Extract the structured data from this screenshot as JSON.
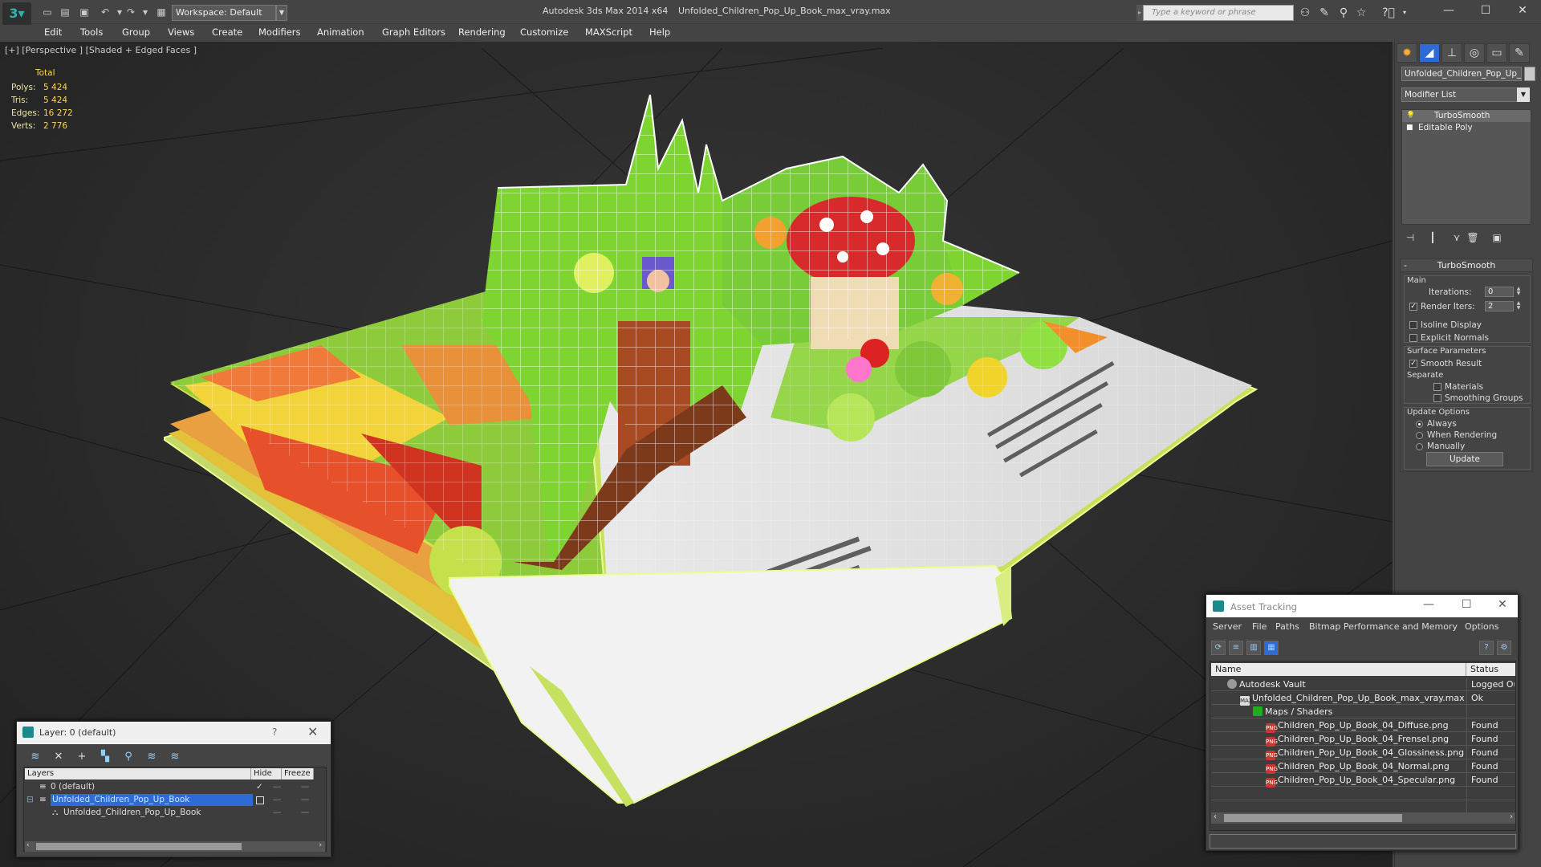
{
  "titlebar": {
    "app_title": "Autodesk 3ds Max  2014 x64",
    "file_title": "Unfolded_Children_Pop_Up_Book_max_vray.max",
    "workspace": "Workspace: Default",
    "search_placeholder": "Type a keyword or phrase"
  },
  "menubar": [
    "Edit",
    "Tools",
    "Group",
    "Views",
    "Create",
    "Modifiers",
    "Animation",
    "Graph Editors",
    "Rendering",
    "Customize",
    "MAXScript",
    "Help"
  ],
  "viewport": {
    "label": "[+] [Perspective ] [Shaded + Edged Faces ]",
    "stats_header": "Total",
    "stats": [
      {
        "key": "Polys:",
        "value": "5 424"
      },
      {
        "key": "Tris:",
        "value": "5 424"
      },
      {
        "key": "Edges:",
        "value": "16 272"
      },
      {
        "key": "Verts:",
        "value": "2 776"
      }
    ]
  },
  "command_panel": {
    "object_name": "Unfolded_Children_Pop_Up_B",
    "modifier_list": "Modifier List",
    "stack": [
      "TurboSmooth",
      "Editable Poly"
    ],
    "rollout": {
      "title": "TurboSmooth",
      "main": "Main",
      "iterations_label": "Iterations:",
      "iterations_value": "0",
      "render_iters_label": "Render Iters:",
      "render_iters_value": "2",
      "isoline": "Isoline Display",
      "explicit_normals": "Explicit Normals",
      "surface_params": "Surface Parameters",
      "smooth_result": "Smooth Result",
      "separate": "Separate",
      "materials": "Materials",
      "smoothing_groups": "Smoothing Groups",
      "update_options": "Update Options",
      "always": "Always",
      "when_rendering": "When Rendering",
      "manually": "Manually",
      "update_button": "Update"
    }
  },
  "layer_dialog": {
    "title": "Layer: 0 (default)",
    "help": "?",
    "columns": [
      "Layers",
      "Hide",
      "Freeze"
    ],
    "rows": [
      "0 (default)",
      "Unfolded_Children_Pop_Up_Book",
      "Unfolded_Children_Pop_Up_Book"
    ]
  },
  "asset_dialog": {
    "title": "Asset Tracking",
    "menu": [
      "Server",
      "File",
      "Paths",
      "Bitmap Performance and Memory",
      "Options"
    ],
    "columns": [
      "Name",
      "Status"
    ],
    "rows": [
      {
        "name": "Autodesk Vault",
        "status": "Logged Out",
        "icon": "vault"
      },
      {
        "name": "Unfolded_Children_Pop_Up_Book_max_vray.max",
        "status": "Ok",
        "icon": "max"
      },
      {
        "name": "Maps / Shaders",
        "status": "",
        "icon": "maps"
      },
      {
        "name": "Children_Pop_Up_Book_04_Diffuse.png",
        "status": "Found",
        "icon": "png"
      },
      {
        "name": "Children_Pop_Up_Book_04_Frensel.png",
        "status": "Found",
        "icon": "png"
      },
      {
        "name": "Children_Pop_Up_Book_04_Glossiness.png",
        "status": "Found",
        "icon": "png"
      },
      {
        "name": "Children_Pop_Up_Book_04_Normal.png",
        "status": "Found",
        "icon": "png"
      },
      {
        "name": "Children_Pop_Up_Book_04_Specular.png",
        "status": "Found",
        "icon": "png"
      }
    ]
  }
}
